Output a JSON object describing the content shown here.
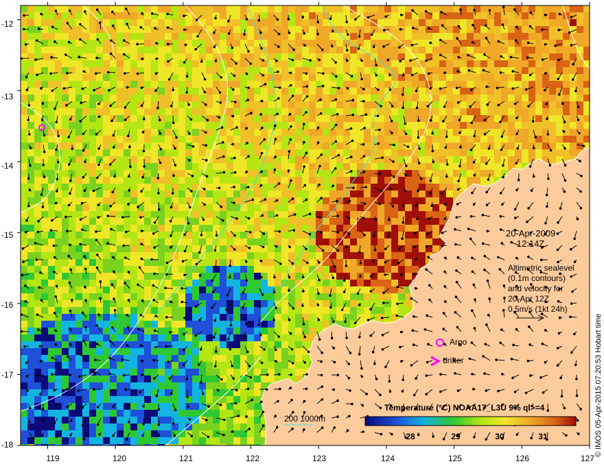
{
  "map": {
    "lon_ticks": [
      "119",
      "120",
      "121",
      "122",
      "123",
      "124",
      "125",
      "126",
      "127"
    ],
    "lat_ticks": [
      "-12",
      "-13",
      "-14",
      "-15",
      "-16",
      "-17",
      "-18"
    ],
    "lon_range": [
      118.6,
      127.0
    ],
    "lat_range": [
      -18.0,
      -11.8
    ]
  },
  "annotation": {
    "date": "20-Apr-2009",
    "time": "12:14Z",
    "alt_line1": "Altimetric sealevel",
    "alt_line2": "(0.1m contours)",
    "alt_line3": "and velocity for",
    "alt_line4": "20-Apr 12Z",
    "alt_line5": "0.5m/s (1kt 24h)"
  },
  "legend": {
    "argo": "Argo",
    "drifter": "drifter",
    "depth": "200  1000m"
  },
  "colorbar": {
    "title": "Temperature (°C) NOAA17_L3U 9% ql>=4",
    "ticks": [
      "28",
      "29",
      "30",
      "31"
    ],
    "range": [
      27.2,
      31.8
    ]
  },
  "credit": "© IMOS 05-Apr-2015 07:20:53 Hobart time",
  "colors": {
    "land": "#fccb9c",
    "argo": "#ff00ff",
    "drifter": "#ff00ff",
    "contour_200": "#40e0d0",
    "sealevel_contour": "#ffffff"
  }
}
